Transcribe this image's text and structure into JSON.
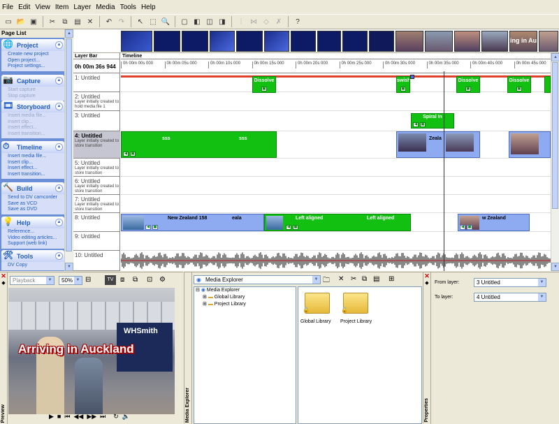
{
  "menu": [
    "File",
    "Edit",
    "View",
    "Item",
    "Layer",
    "Media",
    "Tools",
    "Help"
  ],
  "toolbar": {
    "icons": [
      "new-icon",
      "open-icon",
      "save-icon",
      "cut-icon",
      "copy-icon",
      "paste-icon",
      "delete-icon",
      "undo-icon",
      "redo-icon",
      "pointer-icon",
      "select-icon",
      "zoom-icon",
      "monitor-icon",
      "layers-icon",
      "expand-icon",
      "collapse-icon",
      "split-icon",
      "join-icon",
      "help-icon"
    ]
  },
  "page_list": {
    "title": "Page List",
    "sections": [
      {
        "title": "Project",
        "icon": "globe-icon",
        "items": [
          {
            "label": "Create new project",
            "enabled": true
          },
          {
            "label": "Open project...",
            "enabled": true
          },
          {
            "label": "Project settings...",
            "enabled": true
          }
        ]
      },
      {
        "title": "Capture",
        "icon": "camera-icon",
        "items": [
          {
            "label": "Start capture",
            "enabled": false
          },
          {
            "label": "Stop capture",
            "enabled": false
          }
        ]
      },
      {
        "title": "Storyboard",
        "icon": "storyboard-icon",
        "items": [
          {
            "label": "Insert media file...",
            "enabled": false
          },
          {
            "label": "Insert clip...",
            "enabled": false
          },
          {
            "label": "Insert effect...",
            "enabled": false
          },
          {
            "label": "Insert transition...",
            "enabled": false
          }
        ]
      },
      {
        "title": "Timeline",
        "icon": "timeline-icon",
        "items": [
          {
            "label": "Insert media file...",
            "enabled": true
          },
          {
            "label": "Insert clip...",
            "enabled": true
          },
          {
            "label": "Insert effect...",
            "enabled": true
          },
          {
            "label": "Insert transition...",
            "enabled": true
          }
        ]
      },
      {
        "title": "Build",
        "icon": "build-icon",
        "items": [
          {
            "label": "Send to DV camcorder",
            "enabled": true
          },
          {
            "label": "Save as VCD",
            "enabled": true
          },
          {
            "label": "Save as DVD",
            "enabled": true
          }
        ]
      },
      {
        "title": "Help",
        "icon": "help-icon",
        "items": [
          {
            "label": "Reference...",
            "enabled": true
          },
          {
            "label": "Video editing articles...",
            "enabled": true
          },
          {
            "label": "Support (web link)",
            "enabled": true
          }
        ]
      },
      {
        "title": "Tools",
        "icon": "tools-icon",
        "items": [
          {
            "label": "DV Copy",
            "enabled": true
          }
        ]
      }
    ]
  },
  "filmstrip": {
    "caption": "ing in Auckl"
  },
  "timeline": {
    "layer_bar_label": "Layer Bar",
    "timeline_label": "Timeline",
    "current_time": "0h 00m 36s 944",
    "ticks": [
      "0h 00m 00s 000",
      "0h 00m 05s 000",
      "0h 00m 10s 000",
      "0h 00m 15s 000",
      "0h 00m 20s 000",
      "0h 00m 25s 000",
      "0h 00m 30s 000",
      "0h 00m 35s 000",
      "0h 00m 40s 000",
      "0h 00m 45s 000"
    ],
    "layers": [
      {
        "name": "1: Untitled",
        "desc": ""
      },
      {
        "name": "2: Untitled",
        "desc": "Layer initially created to hold media file 1"
      },
      {
        "name": "3: Untitled",
        "desc": ""
      },
      {
        "name": "4: Untitled",
        "desc": "Layer initially created to store transition"
      },
      {
        "name": "5: Untitled",
        "desc": "Layer initially created to store transition"
      },
      {
        "name": "6: Untitled",
        "desc": "Layer initially created to store transition"
      },
      {
        "name": "7: Untitled",
        "desc": "Layer initially created to store transition"
      },
      {
        "name": "8: Untitled",
        "desc": ""
      },
      {
        "name": "9: Untitled",
        "desc": ""
      },
      {
        "name": "10: Untitled",
        "desc": ""
      }
    ],
    "clips": {
      "dissolve": "Dissolve",
      "swish": "swish",
      "spiral": "Spiral In",
      "ss": "sss",
      "zeala": "Zeala",
      "nz158": "New Zealand 158",
      "eala": "eala",
      "left": "Left aligned",
      "wzeal": "w Zealand"
    }
  },
  "preview": {
    "tab": "Preview",
    "playback": "Playback",
    "zoom": "50%",
    "title_overlay": "Arriving in Auckland",
    "shop": "WHSmith"
  },
  "explorer": {
    "tab": "Media Explorer",
    "root": "Media Explorer",
    "global": "Global Library",
    "project": "Project Library",
    "global_label": "Global Library",
    "project_label": "Project Library"
  },
  "properties": {
    "tab": "Properties",
    "from_label": "From layer:",
    "from_value": "3 Untitled",
    "to_label": "To layer:",
    "to_value": "4 Untitled"
  },
  "colors": {
    "green": "#12c012",
    "blue": "#8eaaf0",
    "panel": "#6b8fd6"
  }
}
